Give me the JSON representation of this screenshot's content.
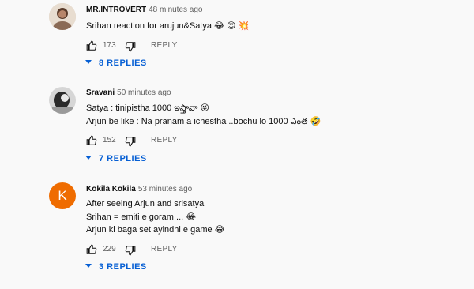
{
  "comments": [
    {
      "author": "MR.INTROVERT",
      "time": "48 minutes ago",
      "lines": [
        "Srihan reaction for arujun&Satya 😂 😍 💥"
      ],
      "likes": "173",
      "reply_label": "REPLY",
      "replies_label": "8 REPLIES",
      "avatar_icon": "person-photo-avatar"
    },
    {
      "author": "Sravani",
      "time": "50 minutes ago",
      "lines": [
        "Satya : tinipistha 1000 ఇస్తావా 😜",
        "Arjun be like : Na pranam a ichestha ..bochu lo 1000 ఎంత 🤣"
      ],
      "likes": "152",
      "reply_label": "REPLY",
      "replies_label": "7 REPLIES",
      "avatar_icon": "photo-avatar"
    },
    {
      "author": "Kokila Kokila",
      "time": "53 minutes ago",
      "lines": [
        "After seeing Arjun and srisatya",
        "Srihan = emiti e goram ... 😂",
        "Arjun ki baga set ayindhi e game 😂"
      ],
      "likes": "229",
      "reply_label": "REPLY",
      "replies_label": "3 REPLIES",
      "avatar_letter": "K",
      "avatar_color": "#ef6c00"
    }
  ],
  "colors": {
    "link": "#065fd4",
    "muted": "#606060",
    "background": "#f9f9f9"
  }
}
